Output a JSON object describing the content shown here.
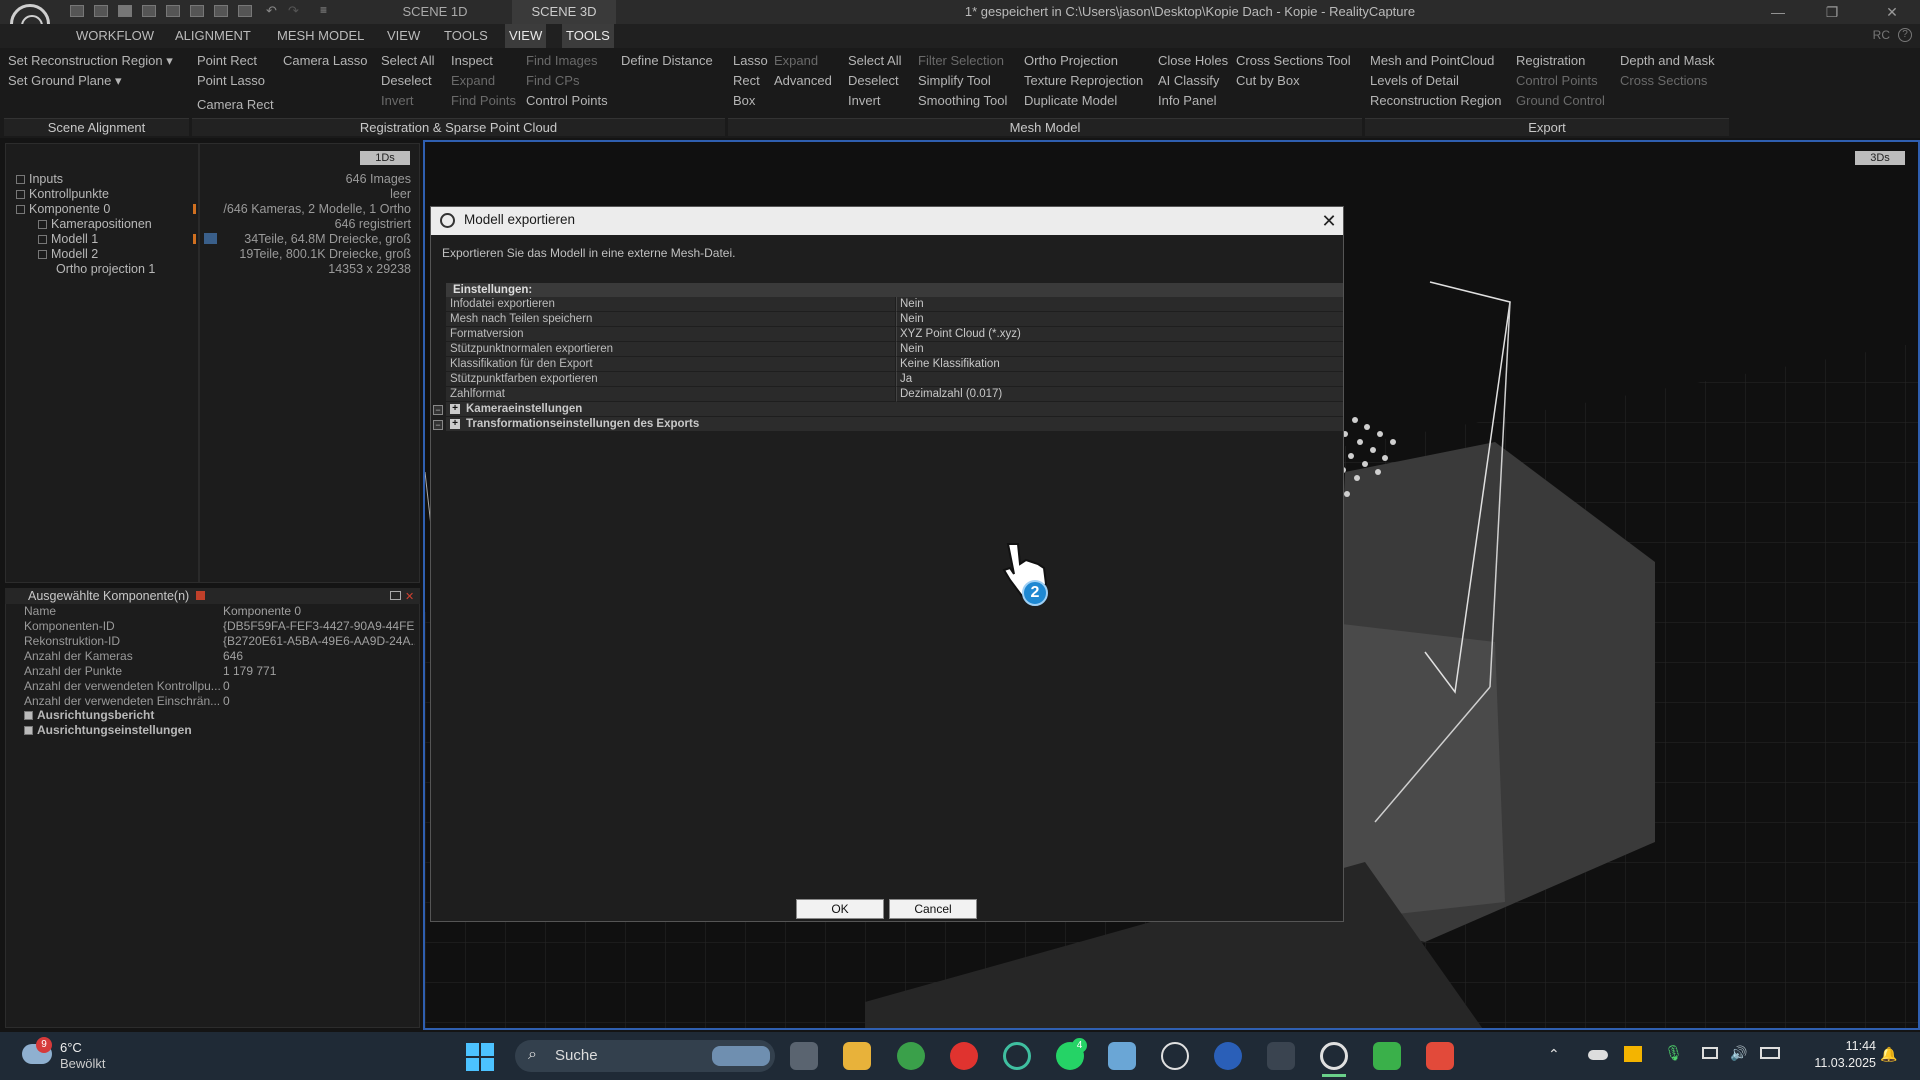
{
  "window": {
    "tabs": [
      "SCENE 1D",
      "SCENE 3D"
    ],
    "title": "1* gespeichert in C:\\Users\\jason\\Desktop\\Kopie Dach - Kopie - RealityCapture",
    "rc_label": "RC"
  },
  "menu": [
    "WORKFLOW",
    "ALIGNMENT",
    "MESH MODEL",
    "VIEW",
    "TOOLS",
    "VIEW",
    "TOOLS"
  ],
  "ribbon": {
    "scene_alignment": [
      "Set Reconstruction Region ▾",
      "Set Ground Plane ▾"
    ],
    "reg_col1": [
      "Point Rect",
      "Point Lasso",
      "Camera Rect"
    ],
    "reg_col2": [
      "Camera Lasso"
    ],
    "reg_col3": [
      "Select All",
      "Deselect",
      "Invert"
    ],
    "reg_col4": [
      "Inspect",
      "Expand",
      "Find Points"
    ],
    "reg_col5": [
      "Find Images",
      "Find CPs",
      "Control Points"
    ],
    "reg_col6": [
      "Define Distance"
    ],
    "mesh_col1": [
      "Lasso",
      "Rect",
      "Box"
    ],
    "mesh_col2": [
      "Expand",
      "Advanced"
    ],
    "mesh_col3": [
      "Select All",
      "Deselect",
      "Invert"
    ],
    "mesh_col4": [
      "Filter Selection",
      "Simplify Tool",
      "Smoothing Tool"
    ],
    "mesh_col5": [
      "Ortho Projection",
      "Texture Reprojection",
      "Duplicate Model"
    ],
    "mesh_col6": [
      "Close Holes",
      "AI Classify",
      "Info Panel"
    ],
    "mesh_col7": [
      "Cross Sections Tool",
      "Cut by Box"
    ],
    "export_col1": [
      "Mesh and PointCloud",
      "Levels of Detail",
      "Reconstruction Region"
    ],
    "export_col2": [
      "Registration",
      "Control Points",
      "Ground Control"
    ],
    "export_col3": [
      "Depth and Mask",
      "Cross Sections"
    ],
    "sections": [
      "Scene Alignment",
      "Registration & Sparse Point Cloud",
      "Mesh Model",
      "Export"
    ]
  },
  "tree": {
    "badge": "1Ds",
    "items": [
      {
        "label": "Inputs",
        "value": "646 Images"
      },
      {
        "label": "Kontrollpunkte",
        "value": "leer"
      },
      {
        "label": "Komponente 0",
        "value": "/646 Kameras, 2 Modelle, 1 Ortho"
      },
      {
        "label": "Kamerapositionen",
        "value": "646 registriert"
      },
      {
        "label": "Modell 1",
        "value": "34Teile, 64.8M Dreiecke, groß"
      },
      {
        "label": "Modell 2",
        "value": "19Teile, 800.1K Dreiecke, groß"
      },
      {
        "label": "Ortho projection 1",
        "value": "14353 x 29238"
      }
    ]
  },
  "selected": {
    "title": "Ausgewählte Komponente(n)",
    "rows": [
      {
        "name": "Name",
        "value": "Komponente 0"
      },
      {
        "name": "Komponenten-ID",
        "value": "{DB5F59FA-FEF3-4427-90A9-44FE..."
      },
      {
        "name": "Rekonstruktion-ID",
        "value": "{B2720E61-A5BA-49E6-AA9D-24A..."
      },
      {
        "name": "Anzahl der Kameras",
        "value": "646"
      },
      {
        "name": "Anzahl der Punkte",
        "value": "1 179 771"
      },
      {
        "name": "Anzahl der verwendeten Kontrollpu...",
        "value": "0"
      },
      {
        "name": "Anzahl der verwendeten Einschrän...",
        "value": "0"
      }
    ],
    "groups": [
      "Ausrichtungsbericht",
      "Ausrichtungseinstellungen"
    ]
  },
  "viewport": {
    "badge": "3Ds"
  },
  "dialog": {
    "title": "Modell exportieren",
    "description": "Exportieren Sie das Modell in eine externe Mesh-Datei.",
    "settings_label": "Einstellungen:",
    "settings": [
      {
        "name": "Infodatei exportieren",
        "value": "Nein"
      },
      {
        "name": "Mesh nach Teilen speichern",
        "value": "Nein"
      },
      {
        "name": "Formatversion",
        "value": "XYZ Point Cloud (*.xyz)"
      },
      {
        "name": "Stützpunktnormalen exportieren",
        "value": "Nein"
      },
      {
        "name": "Klassifikation für den Export",
        "value": "Keine Klassifikation"
      },
      {
        "name": "Stützpunktfarben exportieren",
        "value": "Ja"
      },
      {
        "name": "Zahlformat",
        "value": "Dezimalzahl (0.017)"
      }
    ],
    "groups": [
      "Kameraeinstellungen",
      "Transformationseinstellungen des Exports"
    ],
    "ok": "OK",
    "cancel": "Cancel"
  },
  "cursor": {
    "badge": "2"
  },
  "taskbar": {
    "weather_badge": "9",
    "temperature": "6°C",
    "weather": "Bewölkt",
    "search": "Suche",
    "whatsapp_badge": "4",
    "time": "11:44",
    "date": "11.03.2025"
  }
}
